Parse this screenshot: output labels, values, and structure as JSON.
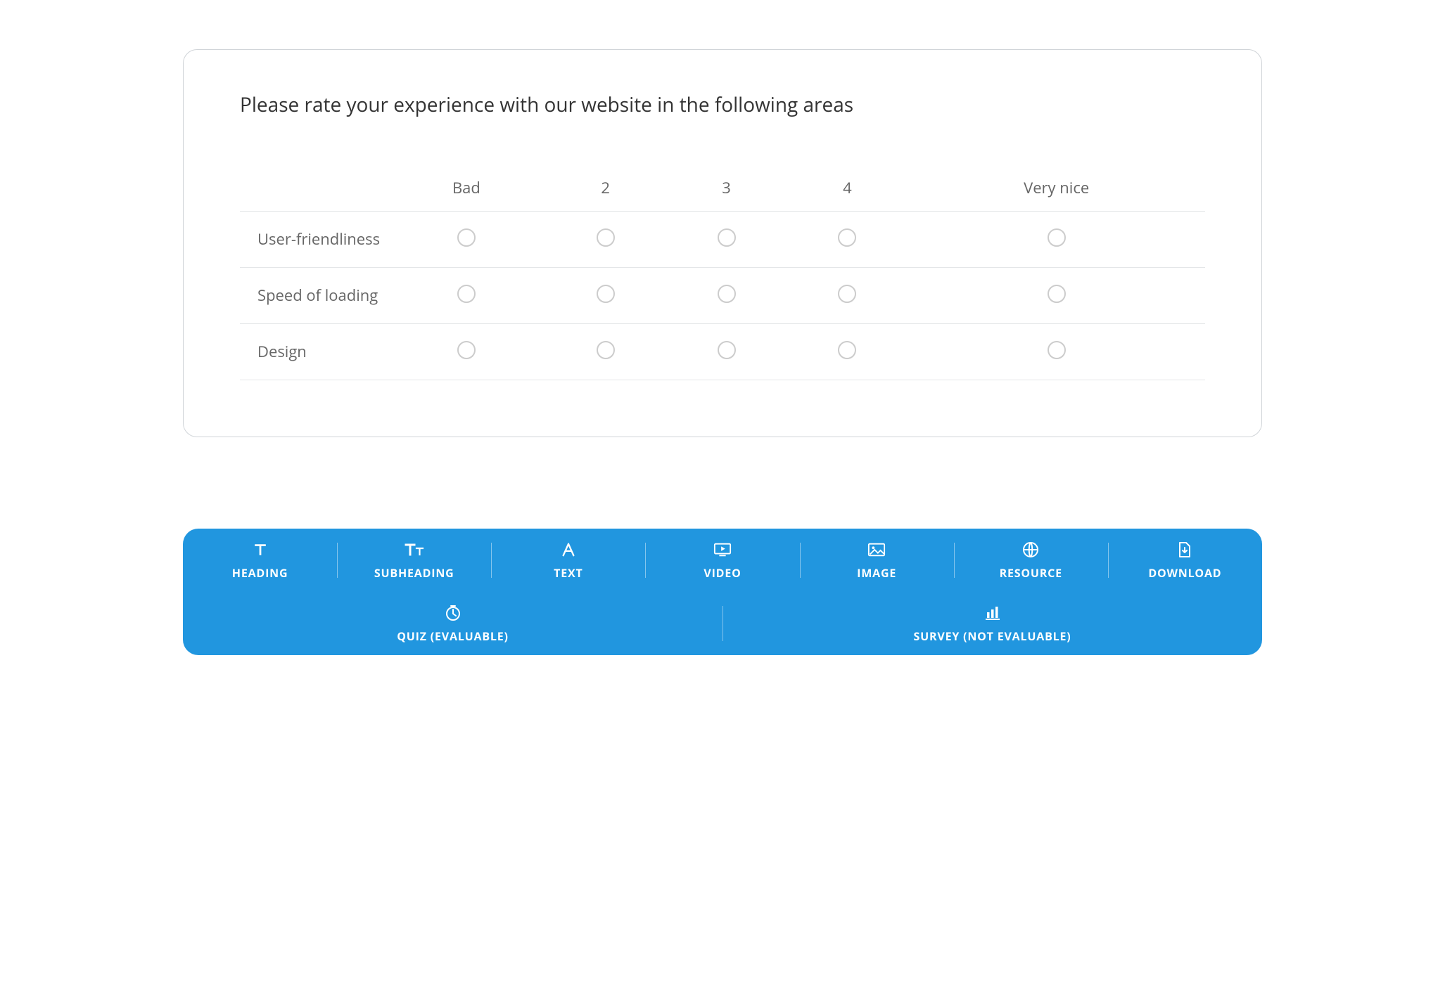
{
  "survey": {
    "question": "Please rate your experience with our website in the following areas",
    "columns": [
      "Bad",
      "2",
      "3",
      "4",
      "Very nice"
    ],
    "rows": [
      "User-friendliness",
      "Speed of loading",
      "Design"
    ]
  },
  "toolbar": {
    "row1": [
      {
        "icon": "heading-icon",
        "label": "HEADING"
      },
      {
        "icon": "subheading-icon",
        "label": "SUBHEADING"
      },
      {
        "icon": "text-icon",
        "label": "TEXT"
      },
      {
        "icon": "video-icon",
        "label": "VIDEO"
      },
      {
        "icon": "image-icon",
        "label": "IMAGE"
      },
      {
        "icon": "resource-icon",
        "label": "RESOURCE"
      },
      {
        "icon": "download-icon",
        "label": "DOWNLOAD"
      }
    ],
    "row2": [
      {
        "icon": "quiz-icon",
        "label": "QUIZ (EVALUABLE)"
      },
      {
        "icon": "survey-icon",
        "label": "SURVEY (NOT EVALUABLE)"
      }
    ]
  }
}
